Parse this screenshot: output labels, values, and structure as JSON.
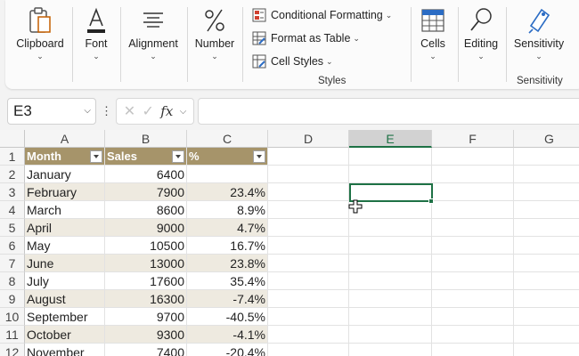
{
  "ribbon": {
    "clipboard": {
      "label": "Clipboard"
    },
    "font": {
      "label": "Font"
    },
    "alignment": {
      "label": "Alignment"
    },
    "number": {
      "label": "Number"
    },
    "styles": {
      "conditional_formatting": "Conditional Formatting",
      "format_as_table": "Format as Table",
      "cell_styles": "Cell Styles",
      "group_label": "Styles"
    },
    "cells": {
      "label": "Cells"
    },
    "editing": {
      "label": "Editing"
    },
    "sensitivity": {
      "label": "Sensitivity",
      "group_label": "Sensitivity"
    }
  },
  "formula_bar": {
    "name_box": "E3",
    "fx": "fx",
    "formula": ""
  },
  "grid": {
    "columns": [
      "A",
      "B",
      "C",
      "D",
      "E",
      "F",
      "G"
    ],
    "selected_column": "E",
    "active_cell": "E3",
    "table_headers": [
      "Month",
      "Sales",
      "%"
    ],
    "rows": [
      {
        "row": "1",
        "month": "Month",
        "sales": "Sales",
        "pct": "%"
      },
      {
        "row": "2",
        "month": "January",
        "sales": "6400",
        "pct": ""
      },
      {
        "row": "3",
        "month": "February",
        "sales": "7900",
        "pct": "23.4%"
      },
      {
        "row": "4",
        "month": "March",
        "sales": "8600",
        "pct": "8.9%"
      },
      {
        "row": "5",
        "month": "April",
        "sales": "9000",
        "pct": "4.7%"
      },
      {
        "row": "6",
        "month": "May",
        "sales": "10500",
        "pct": "16.7%"
      },
      {
        "row": "7",
        "month": "June",
        "sales": "13000",
        "pct": "23.8%"
      },
      {
        "row": "8",
        "month": "July",
        "sales": "17600",
        "pct": "35.4%"
      },
      {
        "row": "9",
        "month": "August",
        "sales": "16300",
        "pct": "-7.4%"
      },
      {
        "row": "10",
        "month": "September",
        "sales": "9700",
        "pct": "-40.5%"
      },
      {
        "row": "11",
        "month": "October",
        "sales": "9300",
        "pct": "-4.1%"
      },
      {
        "row": "12",
        "month": "November",
        "sales": "7400",
        "pct": "-20.4%"
      }
    ]
  },
  "colors": {
    "table_header": "#a6946a",
    "table_band": "#eeeae0",
    "excel_green": "#1e7145"
  }
}
